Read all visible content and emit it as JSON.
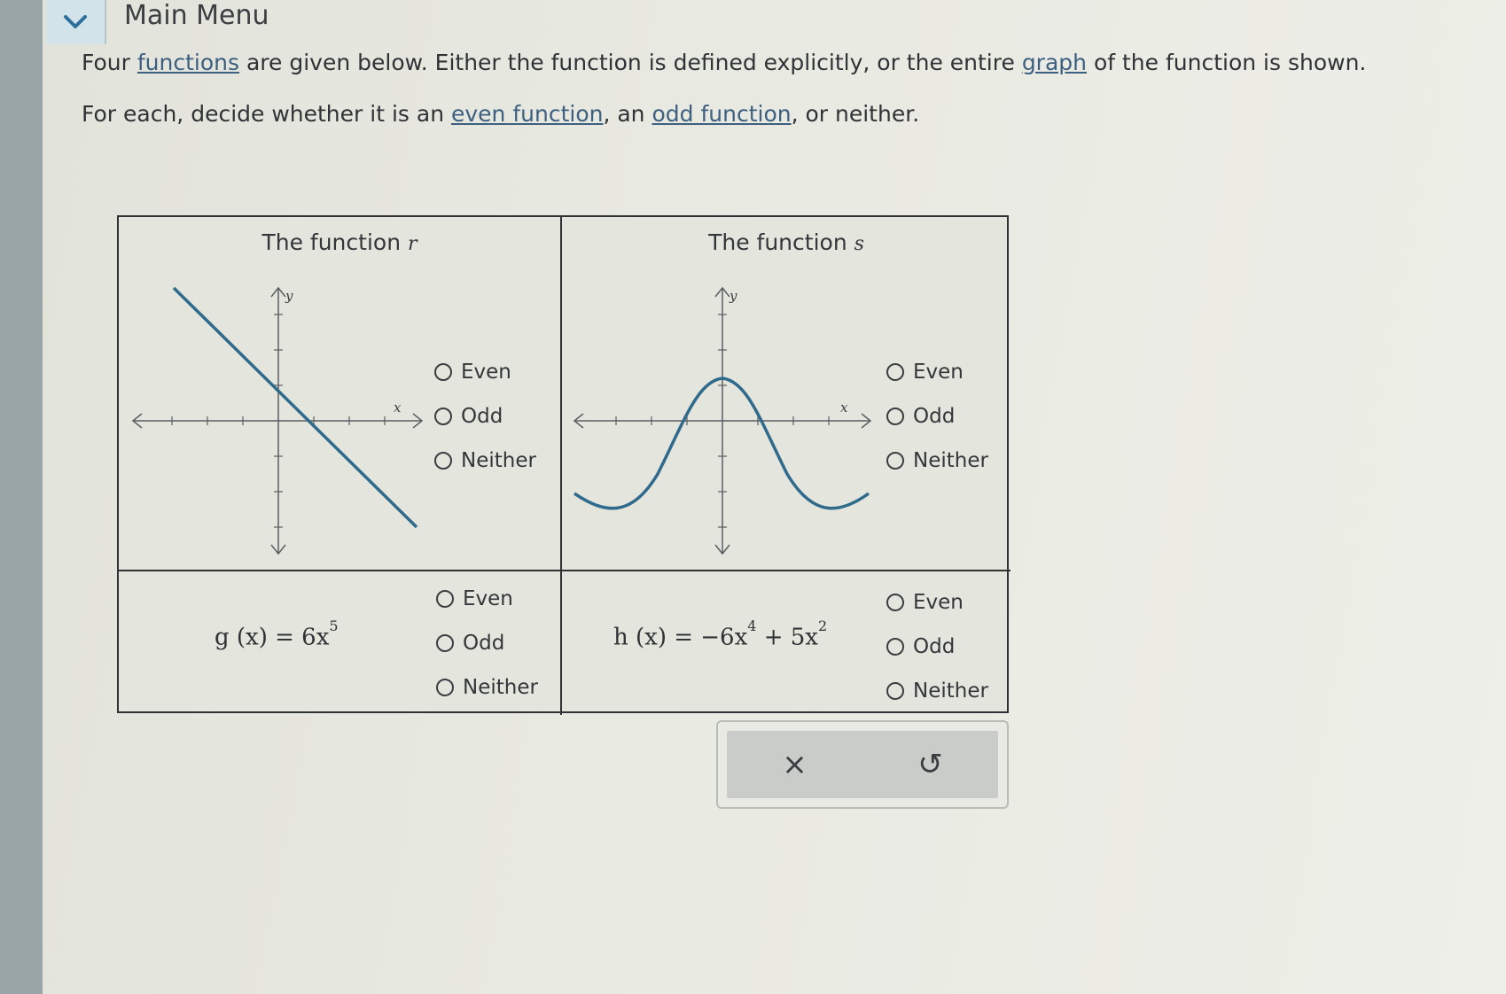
{
  "header": {
    "menu_label": "Main Menu",
    "menu_toggle_icon": "chevron-down-icon"
  },
  "instructions": {
    "line1": {
      "pre": "Four ",
      "link1": "functions",
      "mid": " are given below. Either the function is defined explicitly, or the entire ",
      "link2": "graph",
      "post": " of the function is shown."
    },
    "line2": {
      "pre": "For each, decide whether it is an ",
      "link1": "even function",
      "mid": ", an ",
      "link2": "odd function",
      "post": ", or neither."
    }
  },
  "cells": {
    "r": {
      "title_prefix": "The function ",
      "name": "r",
      "axis_x": "x",
      "axis_y": "y"
    },
    "s": {
      "title_prefix": "The function ",
      "name": "s",
      "axis_x": "x",
      "axis_y": "y"
    },
    "g": {
      "lhs": "g (x) = 6x",
      "exp": "5"
    },
    "h": {
      "lhs": "h (x) = −6x",
      "exp1": "4",
      "mid": " + 5x",
      "exp2": "2"
    }
  },
  "options": {
    "even": "Even",
    "odd": "Odd",
    "neither": "Neither"
  },
  "actions": {
    "clear_symbol": "×",
    "undo_symbol": "↺"
  },
  "colors": {
    "curve": "#2f6a8c",
    "axis": "#5a5f62",
    "menu_toggle_bg": "#d2e3ea",
    "chevron": "#2b6f9a"
  }
}
